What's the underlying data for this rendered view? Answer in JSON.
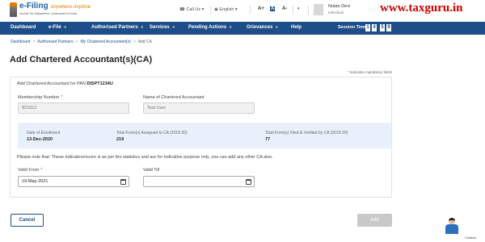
{
  "header": {
    "logo_title": "e-Filing",
    "logo_tagline": "Anywhere Anytime",
    "logo_subtitle": "Income Tax Department, Government of India",
    "call_us": "Call Us",
    "language": "English",
    "text_size": [
      "A+",
      "A",
      "A-"
    ],
    "user_name": "Nutan Devi",
    "user_role": "Individual",
    "watermark": "www.taxguru.in"
  },
  "nav": {
    "items": [
      "Dashboard",
      "e-File",
      "Authorised Partners",
      "Services",
      "Pending Actions",
      "Grievances",
      "Help"
    ],
    "session_label": "Session Time",
    "session_digits": [
      "1",
      "4",
      "5",
      "9"
    ]
  },
  "breadcrumb": [
    "Dashboard",
    "Authorised Partners",
    "My Chartered Accountant(s)",
    "Add CA"
  ],
  "page": {
    "title": "Add Chartered Accountant(s)(CA)",
    "mandatory_note": "* Indicates mandatory fields"
  },
  "form": {
    "heading_prefix": "Add Chartered Accountant for PAN",
    "pan": "DISPT1234U",
    "membership_label": "Membership Number",
    "membership_value": "821812",
    "name_label": "Name of Chartered Accountant",
    "name_value": "Test User",
    "stats": {
      "enrollment_label": "Date of Enrollment",
      "enrollment_value": "13-Dec-2020",
      "assigned_label": "Total Form(s) Assigned to CA (2019-20)",
      "assigned_value": "219",
      "filed_label": "Total Form(s) Filed & Verified by CA (2019-20)",
      "filed_value": "77"
    },
    "note": "Please note that: These indicators/score is as per the statistics and are for indicative purpose only, you can add any other CA also.",
    "valid_from_label": "Valid From",
    "valid_from_value": "19-May-2021",
    "valid_till_label": "Valid Till",
    "valid_till_value": ""
  },
  "buttons": {
    "cancel": "Cancel",
    "add": "Add"
  },
  "chatbot": {
    "label": "Chatbot"
  },
  "colors": {
    "primary": "#1d4e89",
    "watermark": "#d10000",
    "stats_bg": "#e8f1fb",
    "disabled_button": "#c8c8c8"
  },
  "icons": [
    "phone-icon",
    "globe-icon",
    "contrast-icon",
    "calendar-icon",
    "chevron-down-icon"
  ]
}
